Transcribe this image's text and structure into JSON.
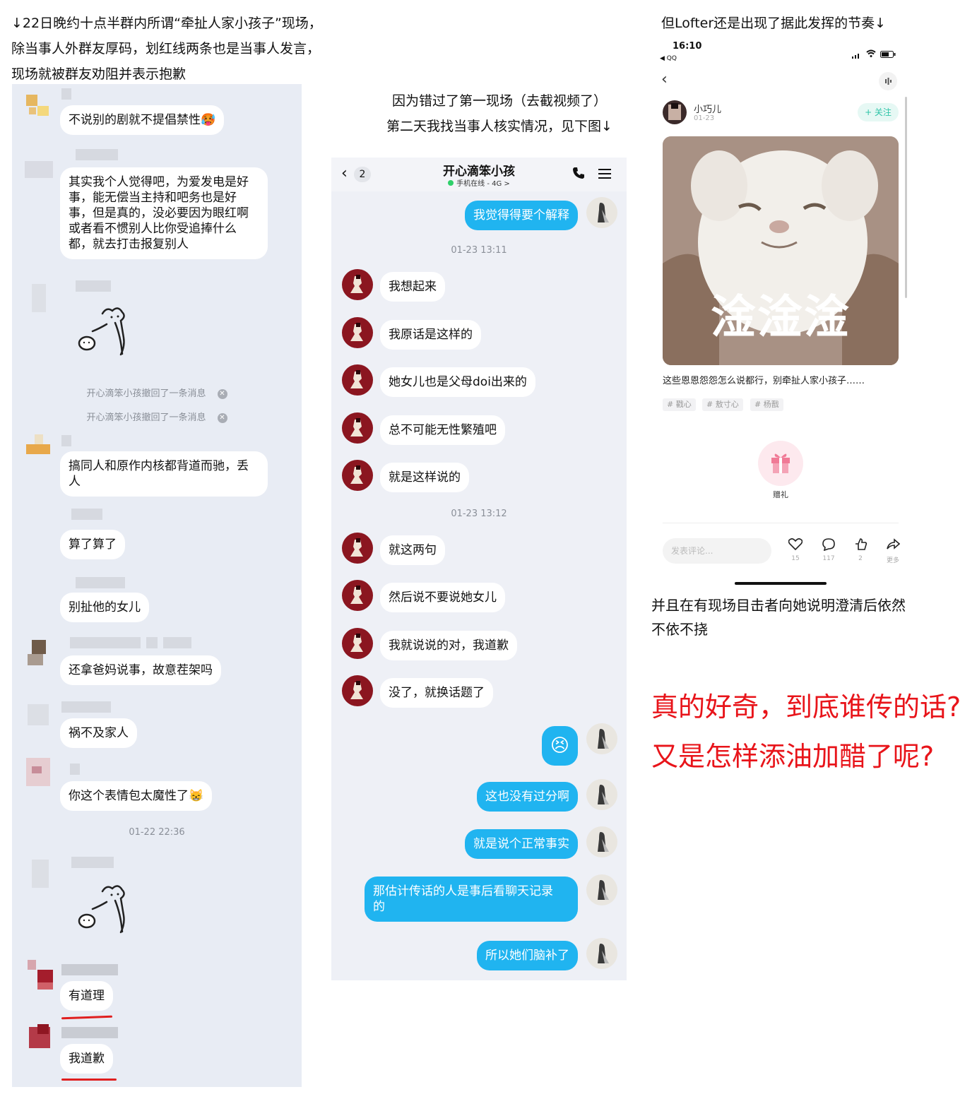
{
  "captions": {
    "left": [
      "↓22日晚约十点半群内所谓“牵扯人家小孩子”现场，",
      "除当事人外群友厚码，划红线两条也是当事人发言，",
      "现场就被群友劝阻并表示抱歉"
    ],
    "middle": [
      "因为错过了第一现场（去截视频了）",
      "第二天我找当事人核实情况，见下图↓"
    ],
    "right": "但Lofter还是出现了据此发挥的节奏↓"
  },
  "left_chat": {
    "messages": [
      "不说别的剧就不提倡禁性🥵",
      "其实我个人觉得吧，为爱发电是好\n事，能无偿当主持和吧务也是好\n事，但是真的，没必要因为眼红啊\n或者看不惯别人比你受追捧什么\n都，就去打击报复别人",
      "搞同人和原作内核都背道而驰，丢\n人",
      "算了算了",
      "别扯他的女儿",
      "还拿爸妈说事，故意茬架吗",
      "祸不及家人",
      "你这个表情包太魔性了😸",
      "有道理",
      "我道歉"
    ],
    "recalls": [
      "开心滴笨小孩撤回了一条消息",
      "开心滴笨小孩撤回了一条消息"
    ],
    "timestamp": "01-22 22:36"
  },
  "mid_chat": {
    "back_count": "2",
    "title": "开心滴笨小孩",
    "status": "手机在线 - 4G >",
    "timestamps": [
      "01-23 13:11",
      "01-23 13:12"
    ],
    "messages": {
      "r1": "我觉得得要个解释",
      "l1": "我想起来",
      "l2": "我原话是这样的",
      "l3": "她女儿也是父母doi出来的",
      "l4": "总不可能无性繁殖吧",
      "l5": "就是这样说的",
      "l6": "就这两句",
      "l7": "然后说不要说她女儿",
      "l8": "我就说说的对，我道歉",
      "l9": "没了，就换话题了",
      "r2": "😣",
      "r3": "这也没有过分啊",
      "r4": "就是说个正常事实",
      "r5": "那估计传话的人是事后看聊天记录\n的",
      "r6": "所以她们脑补了"
    }
  },
  "lofter": {
    "time": "16:10",
    "back_app": "◀ QQ",
    "author": "小巧儿",
    "date": "01-23",
    "follow": "+ 关注",
    "image_caption": "淦淦淦",
    "text": "这些恩恩怨怨怎么说都行，别牵扯人家小孩子……",
    "tags": [
      "# 戳心",
      "# 敖寸心",
      "# 杨戬"
    ],
    "gift": "赠礼",
    "comment_placeholder": "发表评论...",
    "stats": [
      "15",
      "117",
      "2",
      "更多"
    ]
  },
  "notes": {
    "after": [
      "并且在有现场目击者向她说明澄清后依然",
      "不依不挠"
    ],
    "question": [
      "真的好奇，到底谁传的话?",
      "又是怎样添油加醋了呢?"
    ]
  },
  "colors": {
    "accent_blue": "#20b4f0",
    "highlight_red": "#e8141a",
    "follow_green": "#2fc4a8"
  }
}
